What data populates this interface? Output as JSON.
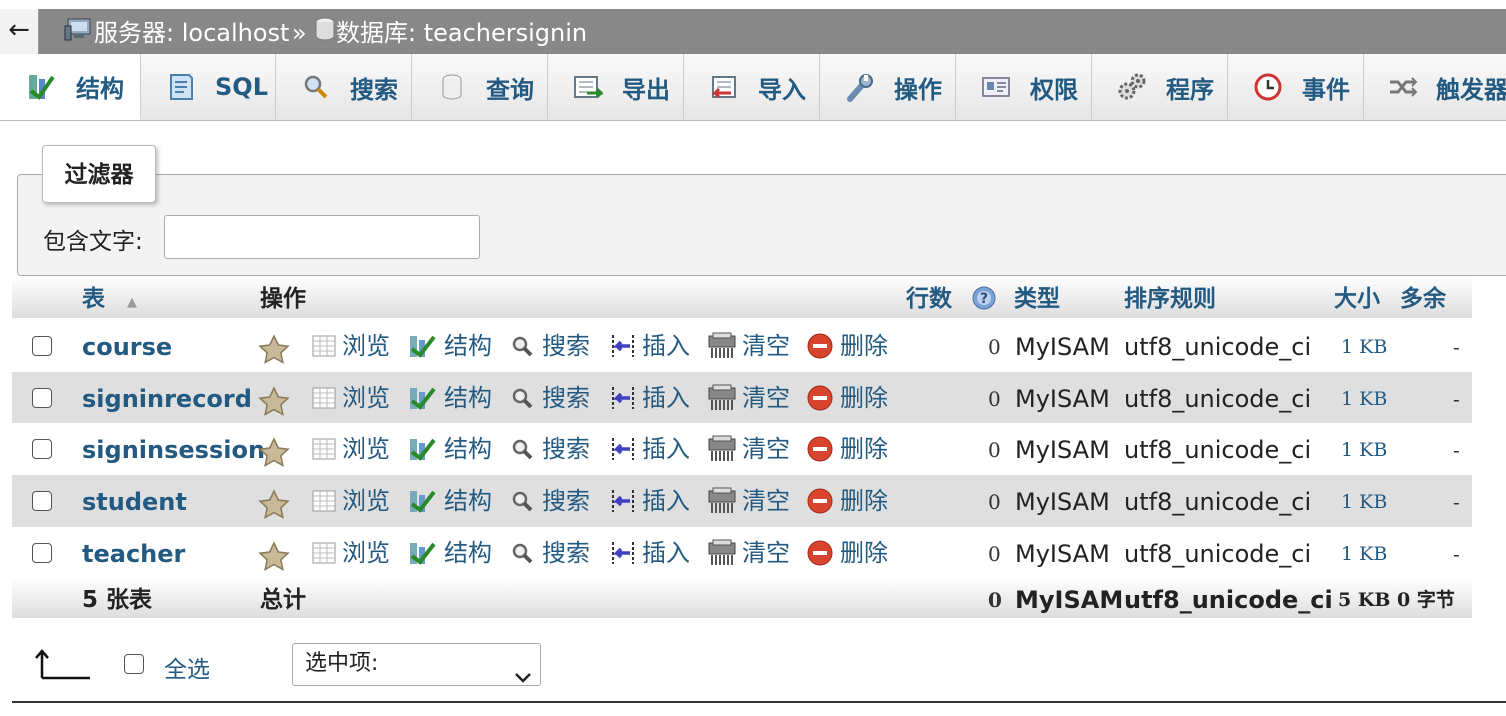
{
  "topbar": {
    "back_label": "←",
    "server": "服务器: localhost",
    "separator": "»",
    "database": "数据库: teachersignin"
  },
  "tabs": [
    {
      "label": "结构",
      "icon": "structure-icon"
    },
    {
      "label": "SQL",
      "icon": "sql-icon"
    },
    {
      "label": "搜索",
      "icon": "search-icon"
    },
    {
      "label": "查询",
      "icon": "query-icon"
    },
    {
      "label": "导出",
      "icon": "export-icon"
    },
    {
      "label": "导入",
      "icon": "import-icon"
    },
    {
      "label": "操作",
      "icon": "wrench-icon"
    },
    {
      "label": "权限",
      "icon": "privileges-icon"
    },
    {
      "label": "程序",
      "icon": "routines-icon"
    },
    {
      "label": "事件",
      "icon": "clock-icon"
    },
    {
      "label": "触发器",
      "icon": "triggers-icon"
    }
  ],
  "filter": {
    "legend": "过滤器",
    "label": "包含文字:",
    "value": ""
  },
  "table": {
    "headers": {
      "table": "表",
      "sort_indicator": "▲",
      "actions": "操作",
      "rows": "行数",
      "type": "类型",
      "collation": "排序规则",
      "size": "大小",
      "overhead": "多余"
    },
    "action_labels": {
      "browse": "浏览",
      "structure": "结构",
      "search": "搜索",
      "insert": "插入",
      "empty": "清空",
      "drop": "删除"
    },
    "rows": [
      {
        "name": "course",
        "rows": "0",
        "type": "MyISAM",
        "collation": "utf8_unicode_ci",
        "size": "1 KB",
        "overhead": "-"
      },
      {
        "name": "signinrecord",
        "rows": "0",
        "type": "MyISAM",
        "collation": "utf8_unicode_ci",
        "size": "1 KB",
        "overhead": "-"
      },
      {
        "name": "signinsession",
        "rows": "0",
        "type": "MyISAM",
        "collation": "utf8_unicode_ci",
        "size": "1 KB",
        "overhead": "-"
      },
      {
        "name": "student",
        "rows": "0",
        "type": "MyISAM",
        "collation": "utf8_unicode_ci",
        "size": "1 KB",
        "overhead": "-"
      },
      {
        "name": "teacher",
        "rows": "0",
        "type": "MyISAM",
        "collation": "utf8_unicode_ci",
        "size": "1 KB",
        "overhead": "-"
      }
    ],
    "footer": {
      "count": "5 张表",
      "total": "总计",
      "rows": "0",
      "type": "MyISAM",
      "collation": "utf8_unicode_ci",
      "size": "5 KB",
      "overhead": "0 字节"
    }
  },
  "bulk": {
    "select_all": "全选",
    "with_selected": "选中项:"
  },
  "colors": {
    "link": "#235a81",
    "topbar": "#888888",
    "row_alt": "#dfdfdf",
    "drop_icon": "#d9442e"
  }
}
